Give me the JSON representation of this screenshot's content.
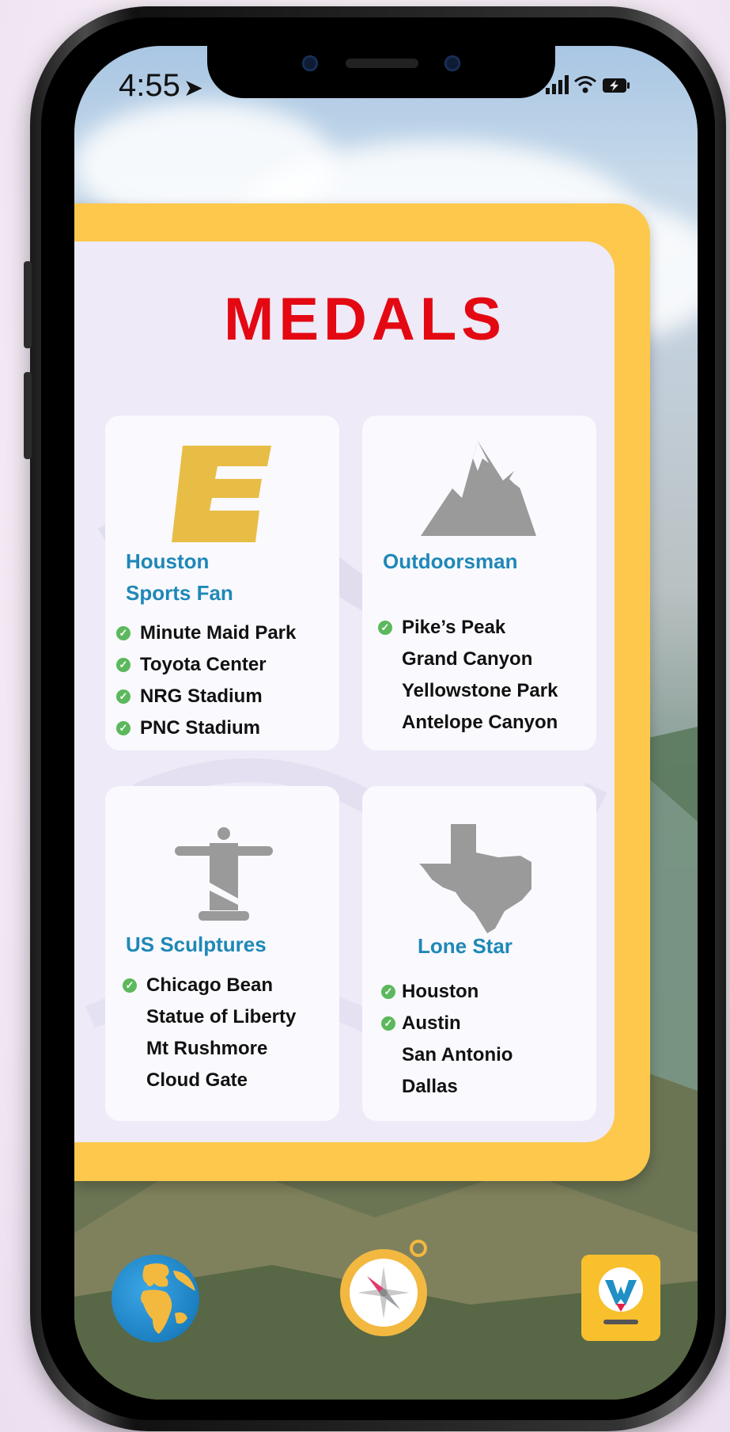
{
  "status_bar": {
    "time": "4:55"
  },
  "medals": {
    "title": "MEDALS",
    "cards": [
      {
        "title_line1": "Houston",
        "title_line2": "Sports Fan",
        "icon": "espn-e-icon",
        "items": [
          {
            "label": "Minute Maid Park",
            "done": true
          },
          {
            "label": "Toyota Center",
            "done": true
          },
          {
            "label": "NRG Stadium",
            "done": true
          },
          {
            "label": "PNC Stadium",
            "done": true
          }
        ]
      },
      {
        "title_line1": "Outdoorsman",
        "icon": "mountain-icon",
        "items": [
          {
            "label": "Pike’s Peak",
            "done": true
          },
          {
            "label": "Grand Canyon",
            "done": false
          },
          {
            "label": "Yellowstone Park",
            "done": false
          },
          {
            "label": "Antelope Canyon",
            "done": false
          }
        ]
      },
      {
        "title_line1": "US Sculptures",
        "icon": "christ-statue-icon",
        "items": [
          {
            "label": "Chicago Bean",
            "done": true
          },
          {
            "label": "Statue of Liberty",
            "done": false
          },
          {
            "label": "Mt Rushmore",
            "done": false
          },
          {
            "label": "Cloud Gate",
            "done": false
          }
        ]
      },
      {
        "title_line1": "Lone Star",
        "icon": "texas-icon",
        "items": [
          {
            "label": "Houston",
            "done": true
          },
          {
            "label": "Austin",
            "done": true
          },
          {
            "label": "San Antonio",
            "done": false
          },
          {
            "label": "Dallas",
            "done": false
          }
        ]
      }
    ]
  },
  "dock": {
    "items": [
      "globe-icon",
      "compass-icon",
      "w-app-icon"
    ]
  },
  "colors": {
    "title_red": "#e30812",
    "card_title_blue": "#1e88b7",
    "frame_yellow": "#fdc84b",
    "check_green": "#5cb85c",
    "icon_gray": "#9a9a9a",
    "espn_yellow": "#e8bd46"
  }
}
